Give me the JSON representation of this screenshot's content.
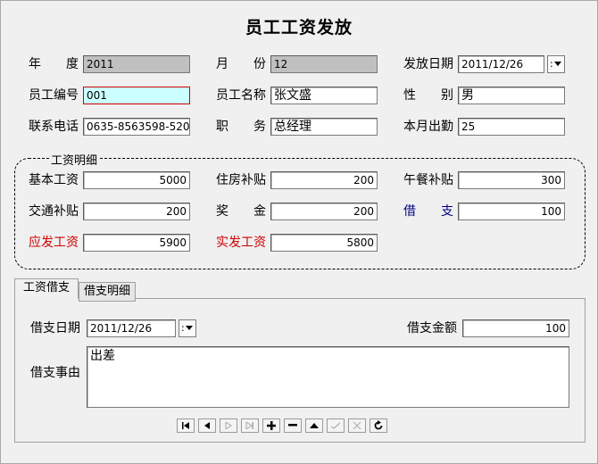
{
  "title": "员工工资发放",
  "header": {
    "year_label": "年度",
    "year_value": "2011",
    "month_label": "月份",
    "month_value": "12",
    "issue_date_label": "发放日期",
    "issue_date_value": "2011/12/26",
    "emp_no_label": "员工编号",
    "emp_no_value": "001",
    "emp_name_label": "员工名称",
    "emp_name_value": "张文盛",
    "gender_label": "性别",
    "gender_value": "男",
    "phone_label": "联系电话",
    "phone_value": "0635-8563598-520",
    "position_label": "职务",
    "position_value": "总经理",
    "attendance_label": "本月出勤",
    "attendance_value": "25"
  },
  "salary": {
    "group_title": "工资明细",
    "base_label": "基本工资",
    "base_value": "5000",
    "housing_label": "住房补贴",
    "housing_value": "200",
    "lunch_label": "午餐补贴",
    "lunch_value": "300",
    "transport_label": "交通补贴",
    "transport_value": "200",
    "bonus_label": "奖金",
    "bonus_value": "200",
    "advance_label": "借支",
    "advance_value": "100",
    "payable_label": "应发工资",
    "payable_value": "5900",
    "actual_label": "实发工资",
    "actual_value": "5800"
  },
  "tabs": [
    {
      "label": "工资借支"
    },
    {
      "label": "借支明细"
    }
  ],
  "loan": {
    "date_label": "借支日期",
    "date_value": "2011/12/26",
    "amount_label": "借支金额",
    "amount_value": "100",
    "reason_label": "借支事由",
    "reason_value": "出差"
  },
  "dropdown_glyph": ":",
  "navigator": {
    "buttons": [
      "first-icon",
      "prior-icon",
      "next-icon",
      "last-icon",
      "insert-icon",
      "delete-icon",
      "edit-icon",
      "post-icon",
      "cancel-icon",
      "refresh-icon"
    ]
  },
  "colors": {
    "accent_red": "#d00000",
    "accent_blue": "#000080",
    "readonly_gray": "#c0c0c0",
    "focus_cyan": "#ccffff"
  }
}
